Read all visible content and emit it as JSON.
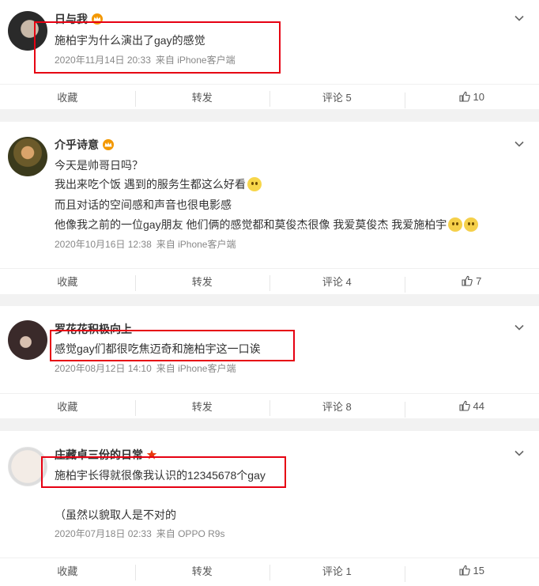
{
  "comments": [
    {
      "user": "日与我",
      "badge": "crown",
      "lines": [
        "施柏宇为什么演出了gay的感觉"
      ],
      "time": "2020年11月14日 20:33",
      "source": "来自 iPhone客户端",
      "actions": {
        "collect": "收藏",
        "repost": "转发",
        "comment": "评论 5",
        "like": "10"
      }
    },
    {
      "user": "介乎诗意",
      "badge": "crown",
      "lines": [
        "今天是帅哥日吗？",
        "我出来吃个饭 遇到的服务生都这么好看",
        "而且对话的空间感和声音也很电影感",
        "他像我之前的一位gay朋友 他们俩的感觉都和莫俊杰很像 我爱莫俊杰 我爱施柏宇"
      ],
      "time": "2020年10月16日 12:38",
      "source": "来自 iPhone客户端",
      "actions": {
        "collect": "收藏",
        "repost": "转发",
        "comment": "评论 4",
        "like": "7"
      }
    },
    {
      "user": "罗花花积极向上",
      "lines": [
        "感觉gay们都很吃焦迈奇和施柏宇这一口诶"
      ],
      "time": "2020年08月12日 14:10",
      "source": "来自 iPhone客户端",
      "actions": {
        "collect": "收藏",
        "repost": "转发",
        "comment": "评论 8",
        "like": "44"
      }
    },
    {
      "user": "庄藏卓三份的日常",
      "badge": "star",
      "lines": [
        "施柏宇长得就很像我认识的12345678个gay",
        "（虽然以貌取人是不对的"
      ],
      "time": "2020年07月18日 02:33",
      "source": "来自 OPPO R9s",
      "actions": {
        "collect": "收藏",
        "repost": "转发",
        "comment": "评论 1",
        "like": "15"
      }
    }
  ],
  "colors": {
    "highlight": "#e60012",
    "crown": "#f39800",
    "star": "#e8380d"
  }
}
